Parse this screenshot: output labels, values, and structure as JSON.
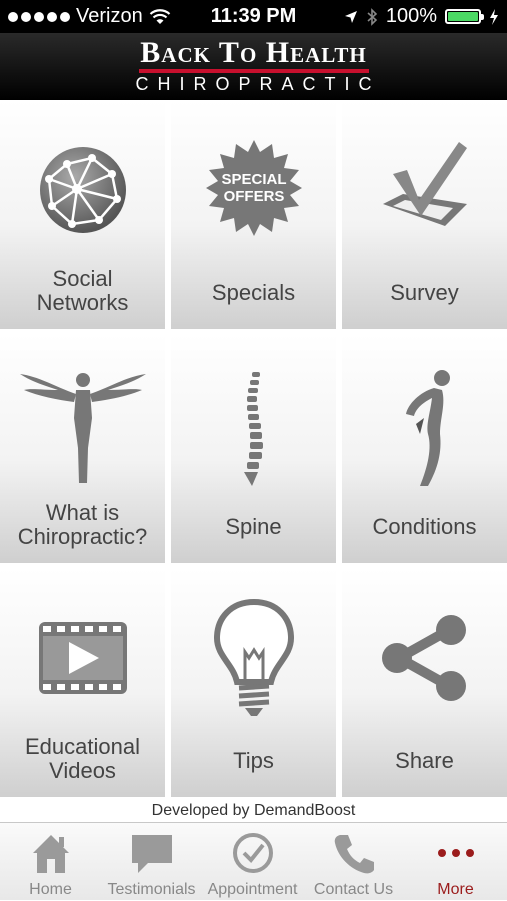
{
  "status_bar": {
    "carrier": "Verizon",
    "time": "11:39 PM",
    "battery": "100%"
  },
  "header": {
    "title_line1": "Back To Health",
    "title_line2": "CHIROPRACTIC",
    "accent_color": "#c8102e"
  },
  "tiles": [
    {
      "label_lines": [
        "Social",
        "Networks"
      ],
      "icon": "globe-network-icon"
    },
    {
      "label_lines": [
        "Specials"
      ],
      "icon": "special-offers-badge-icon",
      "badge_lines": [
        "SPECIAL",
        "OFFERS"
      ]
    },
    {
      "label_lines": [
        "Survey"
      ],
      "icon": "checkmark-box-icon"
    },
    {
      "label_lines": [
        "What is",
        "Chiropractic?"
      ],
      "icon": "winged-figure-icon"
    },
    {
      "label_lines": [
        "Spine"
      ],
      "icon": "spine-icon"
    },
    {
      "label_lines": [
        "Conditions"
      ],
      "icon": "back-pain-figure-icon"
    },
    {
      "label_lines": [
        "Educational",
        "Videos"
      ],
      "icon": "video-play-icon"
    },
    {
      "label_lines": [
        "Tips"
      ],
      "icon": "lightbulb-icon"
    },
    {
      "label_lines": [
        "Share"
      ],
      "icon": "share-icon"
    }
  ],
  "footer": {
    "developed_by": "Developed by DemandBoost"
  },
  "tabbar": {
    "tabs": [
      {
        "label": "Home",
        "icon": "home-icon",
        "active": false
      },
      {
        "label": "Testimonials",
        "icon": "speech-bubble-icon",
        "active": false
      },
      {
        "label": "Appointment",
        "icon": "clock-check-icon",
        "active": false
      },
      {
        "label": "Contact Us",
        "icon": "phone-icon",
        "active": false
      },
      {
        "label": "More",
        "icon": "more-dots-icon",
        "active": true
      }
    ],
    "active_color": "#9b1c1c"
  }
}
